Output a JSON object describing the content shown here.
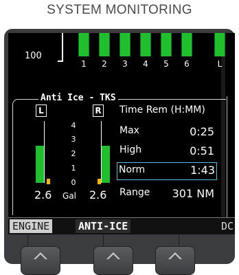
{
  "caption": "SYSTEM MONITORING",
  "engine": {
    "scale_label": "100",
    "cylinder_labels": [
      "1",
      "2",
      "3",
      "4",
      "5",
      "6",
      "L"
    ]
  },
  "anti_ice": {
    "title": "Anti Ice - TKS",
    "left_tag": "L",
    "right_tag": "R",
    "scale": [
      "4",
      "3",
      "2",
      "1",
      "0"
    ],
    "left_qty": "2.6",
    "right_qty": "2.6",
    "unit": "Gal",
    "left_level_fraction": 0.6,
    "right_level_fraction": 0.6,
    "table": {
      "header_label": "Time Rem (H:MM)",
      "rows": [
        {
          "label": "Max",
          "value": "0:25",
          "selected": false
        },
        {
          "label": "High",
          "value": "0:51",
          "selected": false
        },
        {
          "label": "Norm",
          "value": "1:43",
          "selected": true
        },
        {
          "label": "Range",
          "value": "301 NM",
          "selected": false
        }
      ]
    }
  },
  "softkeys": {
    "engine": "ENGINE",
    "anti_ice": "ANTI-ICE",
    "dc": "DC"
  },
  "colors": {
    "bar_green": "#1fbf2e",
    "caution_amber": "#f2b400",
    "selection_cyan": "#52c3e0"
  }
}
